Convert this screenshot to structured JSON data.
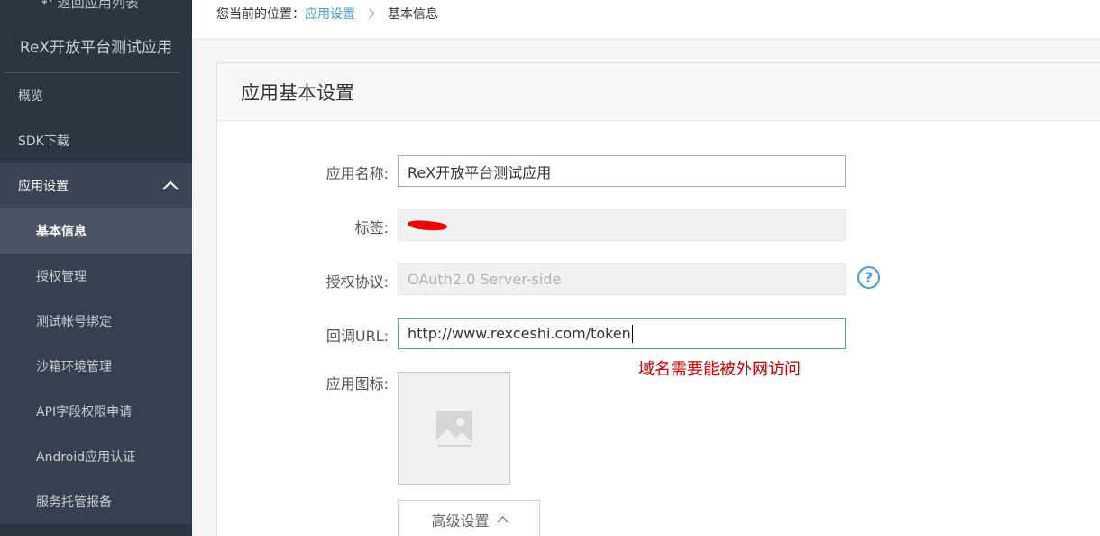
{
  "sidebar": {
    "back_label": "返回应用列表",
    "app_title": "ReX开放平台测试应用",
    "items": [
      {
        "label": "概览"
      },
      {
        "label": "SDK下载"
      },
      {
        "label": "应用设置"
      },
      {
        "label": "基本信息"
      },
      {
        "label": "授权管理"
      },
      {
        "label": "测试帐号绑定"
      },
      {
        "label": "沙箱环境管理"
      },
      {
        "label": "API字段权限申请"
      },
      {
        "label": "Android应用认证"
      },
      {
        "label": "服务托管报备"
      }
    ]
  },
  "breadcrumb": {
    "prefix": "您当前的位置：",
    "parent": "应用设置",
    "current": "基本信息"
  },
  "panel": {
    "title": "应用基本设置"
  },
  "form": {
    "name_label": "应用名称:",
    "name_value": "ReX开放平台测试应用",
    "tag_label": "标签:",
    "protocol_label": "授权协议:",
    "protocol_value": "OAuth2.0 Server-side",
    "help_glyph": "?",
    "callback_label": "回调URL:",
    "callback_value": "http://www.rexceshi.com/token",
    "annotation": "域名需要能被外网访问",
    "icon_label": "应用图标:",
    "advanced_label": "高级设置"
  },
  "colors": {
    "sidebar_bg": "#2b3643",
    "link_blue": "#4a9bd6",
    "annotation_red": "#c80000"
  }
}
